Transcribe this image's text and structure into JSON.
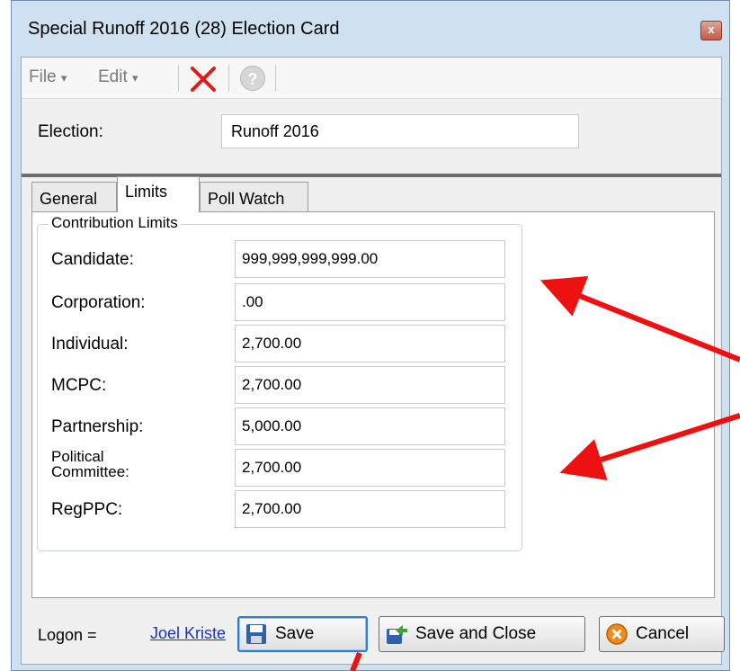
{
  "window": {
    "title": "Special Runoff 2016 (28) Election Card",
    "close_label": "x"
  },
  "toolbar": {
    "file_label": "File",
    "edit_label": "Edit",
    "dropdown_glyph": "▾",
    "delete_icon": "delete-x-icon",
    "help_icon": "help-icon"
  },
  "election": {
    "label": "Election:",
    "value": "Runoff 2016"
  },
  "tabs": [
    {
      "label": "General",
      "active": false
    },
    {
      "label": "Limits",
      "active": true
    },
    {
      "label": "Poll Watch",
      "active": false
    }
  ],
  "limits": {
    "group_title": "Contribution Limits",
    "rows": [
      {
        "label": "Candidate:",
        "value": "999,999,999,999.00"
      },
      {
        "label": "Corporation:",
        "value": ".00"
      },
      {
        "label": "Individual:",
        "value": "2,700.00"
      },
      {
        "label": "MCPC:",
        "value": "2,700.00"
      },
      {
        "label": "Partnership:",
        "value": "5,000.00"
      },
      {
        "label": "Political Committee:",
        "value": "2,700.00"
      },
      {
        "label": "RegPPC:",
        "value": "2,700.00"
      }
    ]
  },
  "footer": {
    "logon_label": "Logon =",
    "logon_user": "Joel Kriste",
    "save_label": "Save",
    "save_close_label": "Save and Close",
    "cancel_label": "Cancel"
  },
  "colors": {
    "annotation_arrow": "#ee1111",
    "link": "#1a31c8"
  }
}
